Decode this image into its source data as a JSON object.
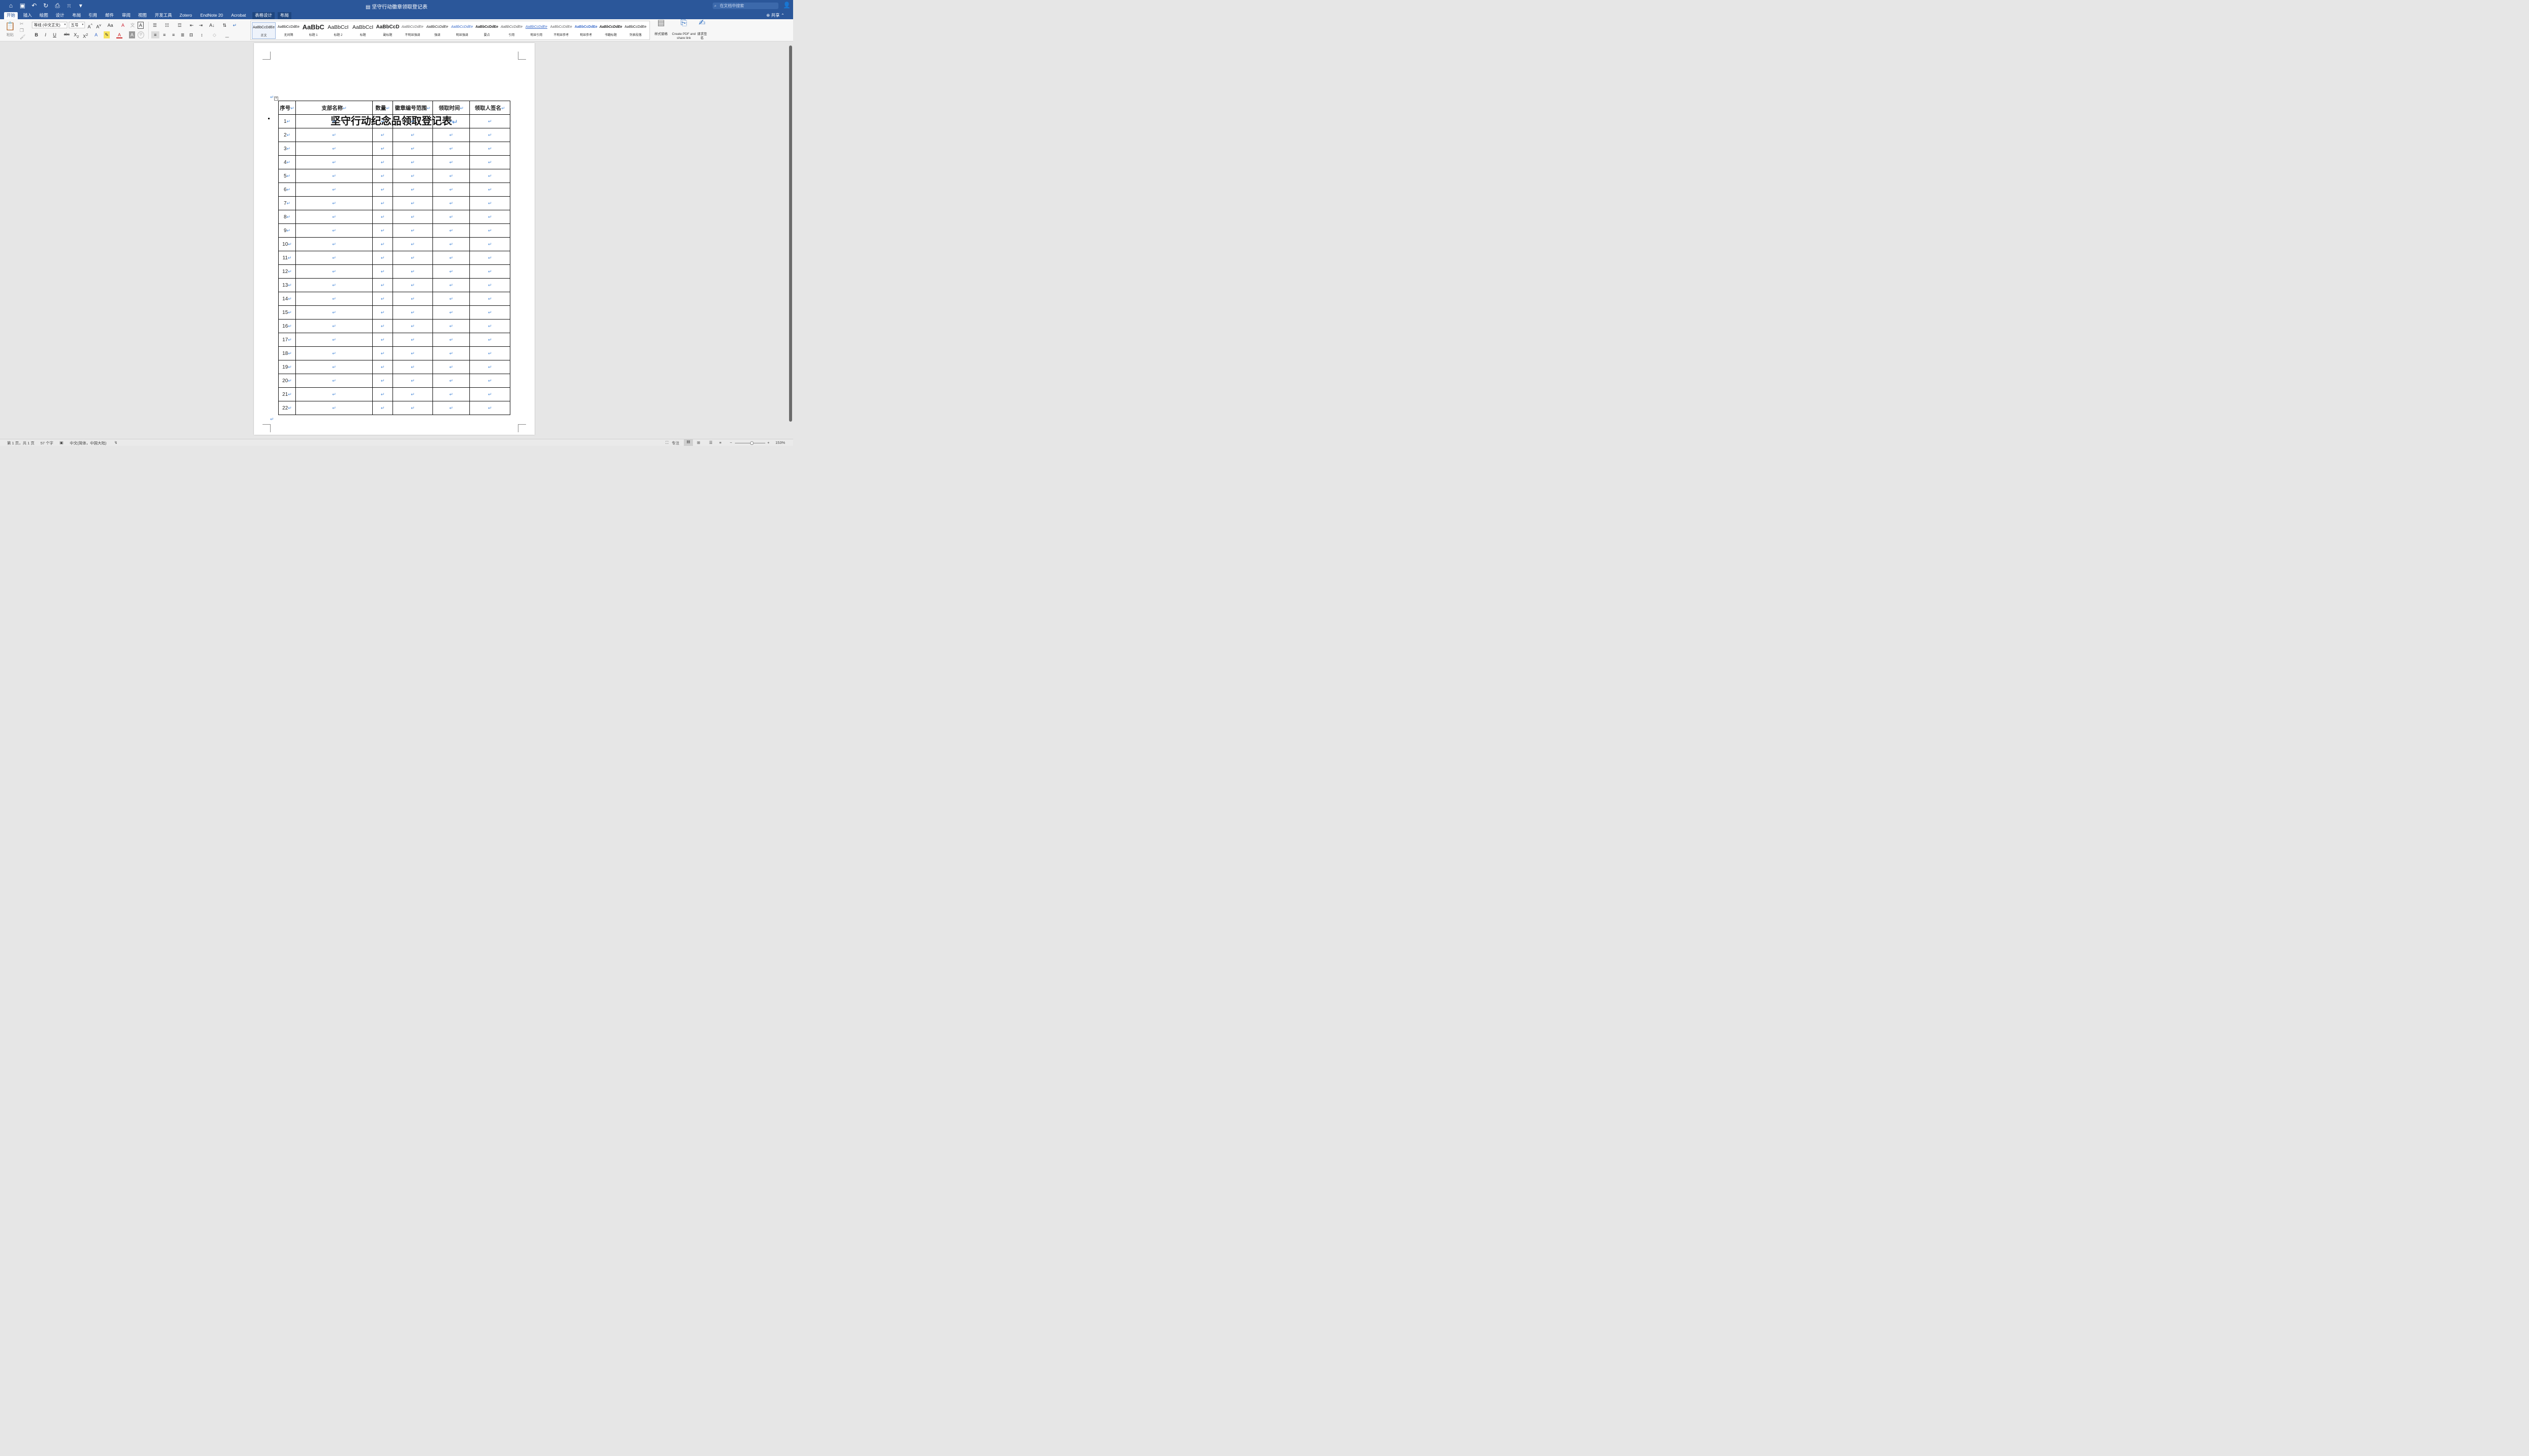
{
  "titlebar": {
    "doc_title": "坚守行动徽章领取登记表",
    "search_placeholder": "在文档中搜索",
    "share_label": "共享"
  },
  "tabs": [
    "开始",
    "插入",
    "绘图",
    "设计",
    "布局",
    "引用",
    "邮件",
    "审阅",
    "视图",
    "开发工具",
    "Zotero",
    "EndNote 20",
    "Acrobat",
    "表格设计",
    "布局"
  ],
  "ribbon": {
    "paste_label": "粘贴",
    "font_name": "等线 (中文正文)",
    "font_size": "五号",
    "styles": [
      {
        "preview": "AaBbCcDdEe",
        "label": "正文"
      },
      {
        "preview": "AaBbCcDdEe",
        "label": "无间隔"
      },
      {
        "preview": "AaBbC",
        "label": "标题 1"
      },
      {
        "preview": "AaBbCcI",
        "label": "标题 2"
      },
      {
        "preview": "AaBbCcI",
        "label": "标题"
      },
      {
        "preview": "AaBbCcD",
        "label": "副标题"
      },
      {
        "preview": "AaBbCcDdEe",
        "label": "不明显强调"
      },
      {
        "preview": "AaBbCcDdEe",
        "label": "强调"
      },
      {
        "preview": "AaBbCcDdEe",
        "label": "明显强调"
      },
      {
        "preview": "AaBbCcDdEe",
        "label": "要点"
      },
      {
        "preview": "AaBbCcDdEe",
        "label": "引用"
      },
      {
        "preview": "AaBbCcDdEe",
        "label": "明显引用"
      },
      {
        "preview": "AaBbCcDdEe",
        "label": "不明显参考"
      },
      {
        "preview": "AaBbCcDdEe",
        "label": "明显参考"
      },
      {
        "preview": "AaBbCcDdEe",
        "label": "书籍标题"
      },
      {
        "preview": "AaBbCcDdEe",
        "label": "列表段落"
      }
    ],
    "style_pane_label": "样式窗格",
    "create_pdf_label": "Create PDF and share link",
    "request_sign_label": "请求签名"
  },
  "document": {
    "heading": "坚守行动纪念品领取登记表",
    "para_mark": "↵",
    "columns": [
      "序号",
      "支部名称",
      "数量",
      "徽章编号范围",
      "领取时间",
      "领取人签名"
    ],
    "row_numbers": [
      "1",
      "2",
      "3",
      "4",
      "5",
      "6",
      "7",
      "8",
      "9",
      "10",
      "11",
      "12",
      "13",
      "14",
      "15",
      "16",
      "17",
      "18",
      "19",
      "20",
      "21",
      "22"
    ]
  },
  "statusbar": {
    "page_info": "第 1 页，共 1 页",
    "word_count": "57 个字",
    "language": "中文(简体，中国大陆)",
    "focus": "专注",
    "zoom": "153%"
  }
}
